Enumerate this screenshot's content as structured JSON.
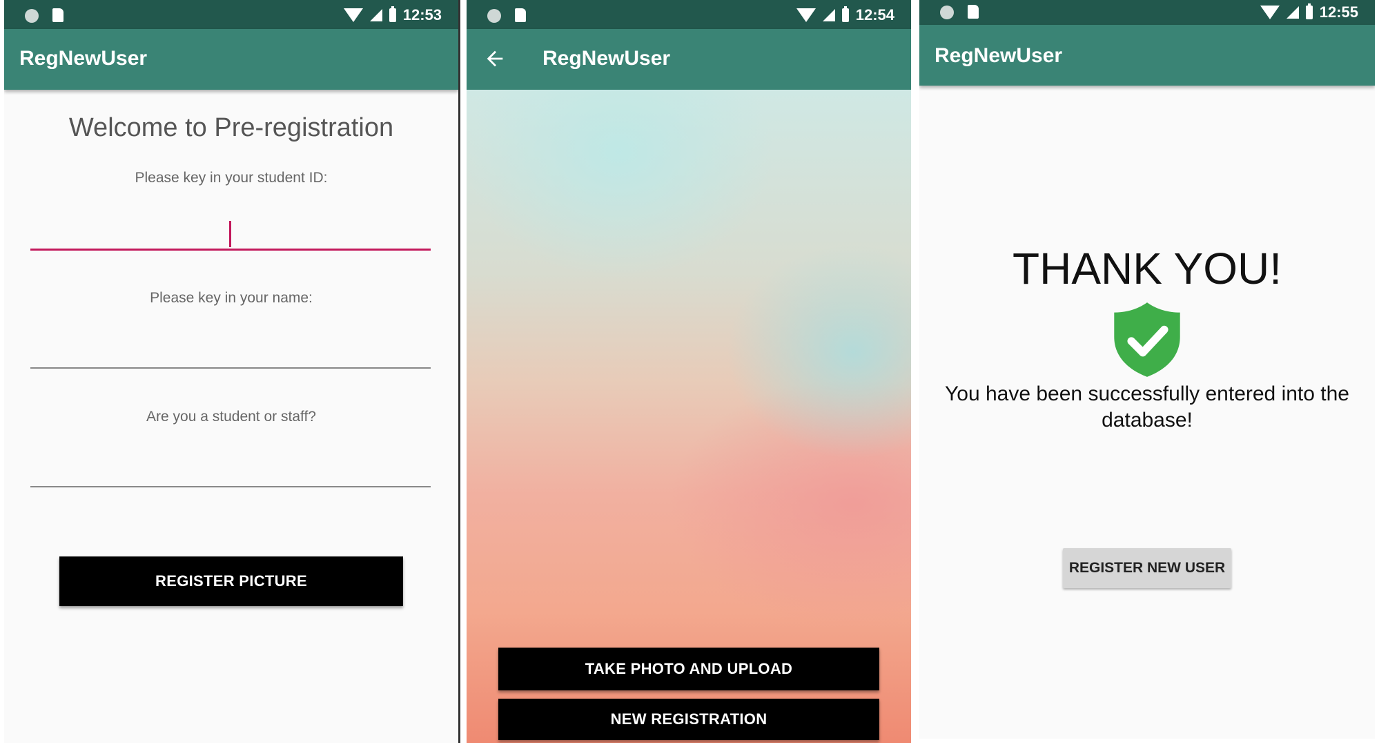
{
  "screens": [
    {
      "time": "12:53",
      "app_title": "RegNewUser",
      "welcome": "Welcome to Pre-registration",
      "student_id_label": "Please key in your student ID:",
      "student_id_value": "",
      "name_label": "Please key in your name:",
      "name_value": "",
      "role_label": "Are you a student or staff?",
      "role_value": "",
      "register_picture_button": "REGISTER PICTURE"
    },
    {
      "time": "12:54",
      "app_title": "RegNewUser",
      "take_photo_button": "TAKE PHOTO AND UPLOAD",
      "new_registration_button": "NEW REGISTRATION"
    },
    {
      "time": "12:55",
      "app_title": "RegNewUser",
      "thank_you": "THANK YOU!",
      "success_message": "You have been successfully entered into the database!",
      "register_new_user_button": "REGISTER NEW USER"
    }
  ],
  "colors": {
    "status_bar": "#22584d",
    "app_bar": "#3a8475",
    "accent": "#c2185b",
    "success_green": "#3fae49"
  },
  "icons": [
    "notification-dot-icon",
    "sd-card-icon",
    "wifi-icon",
    "signal-icon",
    "battery-icon",
    "back-arrow-icon",
    "shield-check-icon"
  ]
}
